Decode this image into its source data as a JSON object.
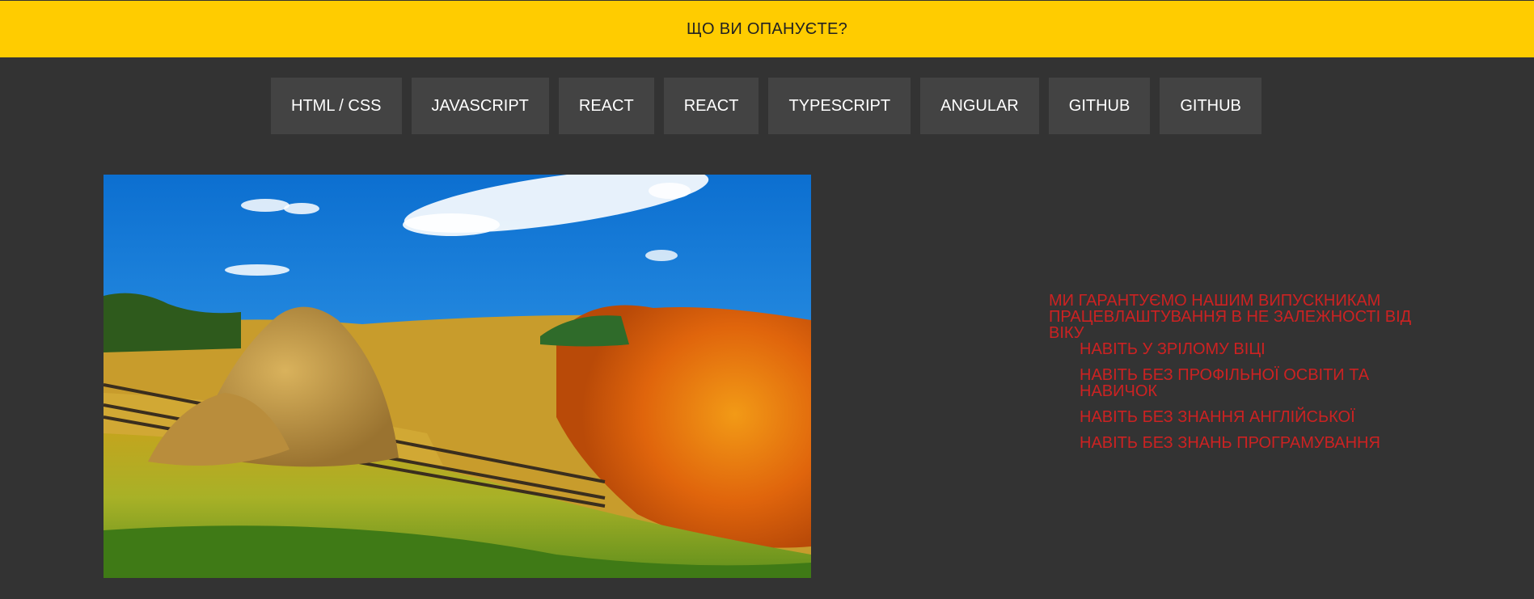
{
  "banner": {
    "title": "ЩО ВИ ОПАНУЄТЕ?",
    "background": "#ffcc00"
  },
  "nav": {
    "tabs": [
      {
        "label": "HTML / CSS"
      },
      {
        "label": "JAVASCRIPT"
      },
      {
        "label": "REACT"
      },
      {
        "label": "REACT"
      },
      {
        "label": "TYPESCRIPT"
      },
      {
        "label": "ANGULAR"
      },
      {
        "label": "GITHUB"
      },
      {
        "label": "GITHUB"
      }
    ]
  },
  "hero": {
    "image": "autumn-hills-haystack-photo"
  },
  "promo": {
    "heading": "МИ ГАРАНТУЄМО НАШИМ ВИПУСКНИКАМ ПРАЦЕВЛАШТУВАННЯ В НЕ ЗАЛЕЖНОСТІ ВІД ВІКУ",
    "items": [
      "НАВІТЬ У ЗРІЛОМУ ВІЦІ",
      "НАВІТЬ БЕЗ ПРОФІЛЬНОЇ ОСВІТИ ТА НАВИЧОК",
      "НАВІТЬ БЕЗ ЗНАННЯ АНГЛІЙСЬКОЇ",
      "НАВІТЬ БЕЗ ЗНАНЬ ПРОГРАМУВАННЯ"
    ],
    "color": "#cc2222"
  },
  "colors": {
    "page_background": "#333333",
    "tab_background": "#434343"
  }
}
